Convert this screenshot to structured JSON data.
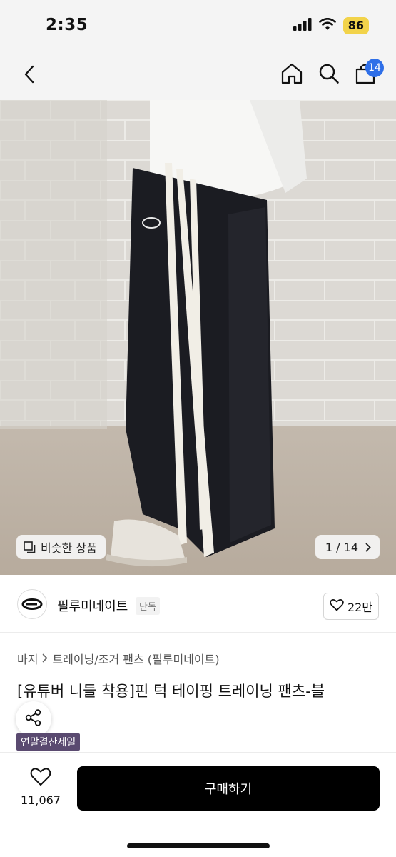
{
  "status_bar": {
    "time": "2:35",
    "battery": "86"
  },
  "nav": {
    "cart_count": "14"
  },
  "gallery": {
    "similar_label": "비슷한 상품",
    "counter": "1 / 14"
  },
  "brand": {
    "name": "필루미네이트",
    "tag": "단독",
    "likes": "22만"
  },
  "breadcrumb": {
    "category": "바지",
    "subcategory": "트레이닝/조거 팬츠 (필루미네이트)"
  },
  "product": {
    "title": "[유튜버 니들 착용]핀 턱 테이핑 트레이닝 팬츠-블",
    "sale_tag": "연말결산세일"
  },
  "bottom_bar": {
    "wish_count": "11,067",
    "buy_label": "구매하기"
  },
  "colors": {
    "accent_badge": "#2f6fe8",
    "battery": "#f2d34a",
    "buy_button": "#000000",
    "sale_tag": "#5a4a70"
  },
  "icons": [
    "back-icon",
    "home-icon",
    "search-icon",
    "cart-icon",
    "similar-icon",
    "chevron-right-icon",
    "heart-icon",
    "share-icon"
  ]
}
